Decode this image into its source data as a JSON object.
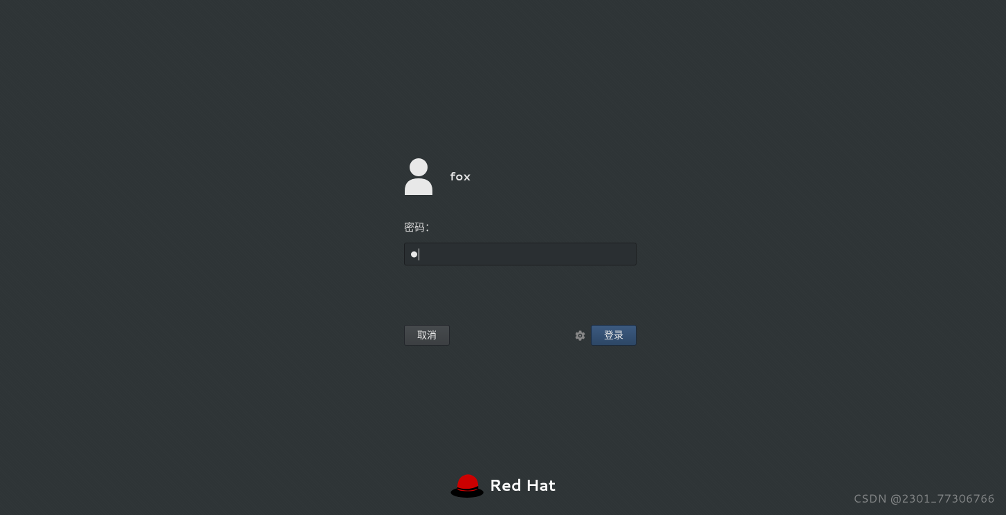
{
  "user": {
    "name": "fox"
  },
  "password": {
    "label": "密码：",
    "masked_chars": 1
  },
  "buttons": {
    "cancel": "取消",
    "login": "登录"
  },
  "brand": {
    "name": "Red Hat"
  },
  "watermark": "CSDN @2301_77306766"
}
